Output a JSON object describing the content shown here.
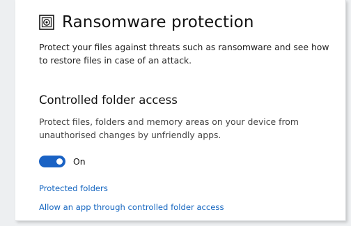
{
  "header": {
    "title": "Ransomware protection",
    "icon": "ransomware-shield-icon"
  },
  "intro": {
    "text": "Protect your files against threats such as ransomware and see how to restore files in case of an attack."
  },
  "controlled_folder_access": {
    "heading": "Controlled folder access",
    "description": "Protect files, folders and memory areas on your device from unauthorised changes by unfriendly apps.",
    "toggle_state": "On",
    "toggle_on": true
  },
  "links": {
    "protected_folders": "Protected folders",
    "allow_app": "Allow an app through controlled folder access"
  },
  "colors": {
    "accent": "#1a62c4",
    "link": "#1566c0"
  }
}
